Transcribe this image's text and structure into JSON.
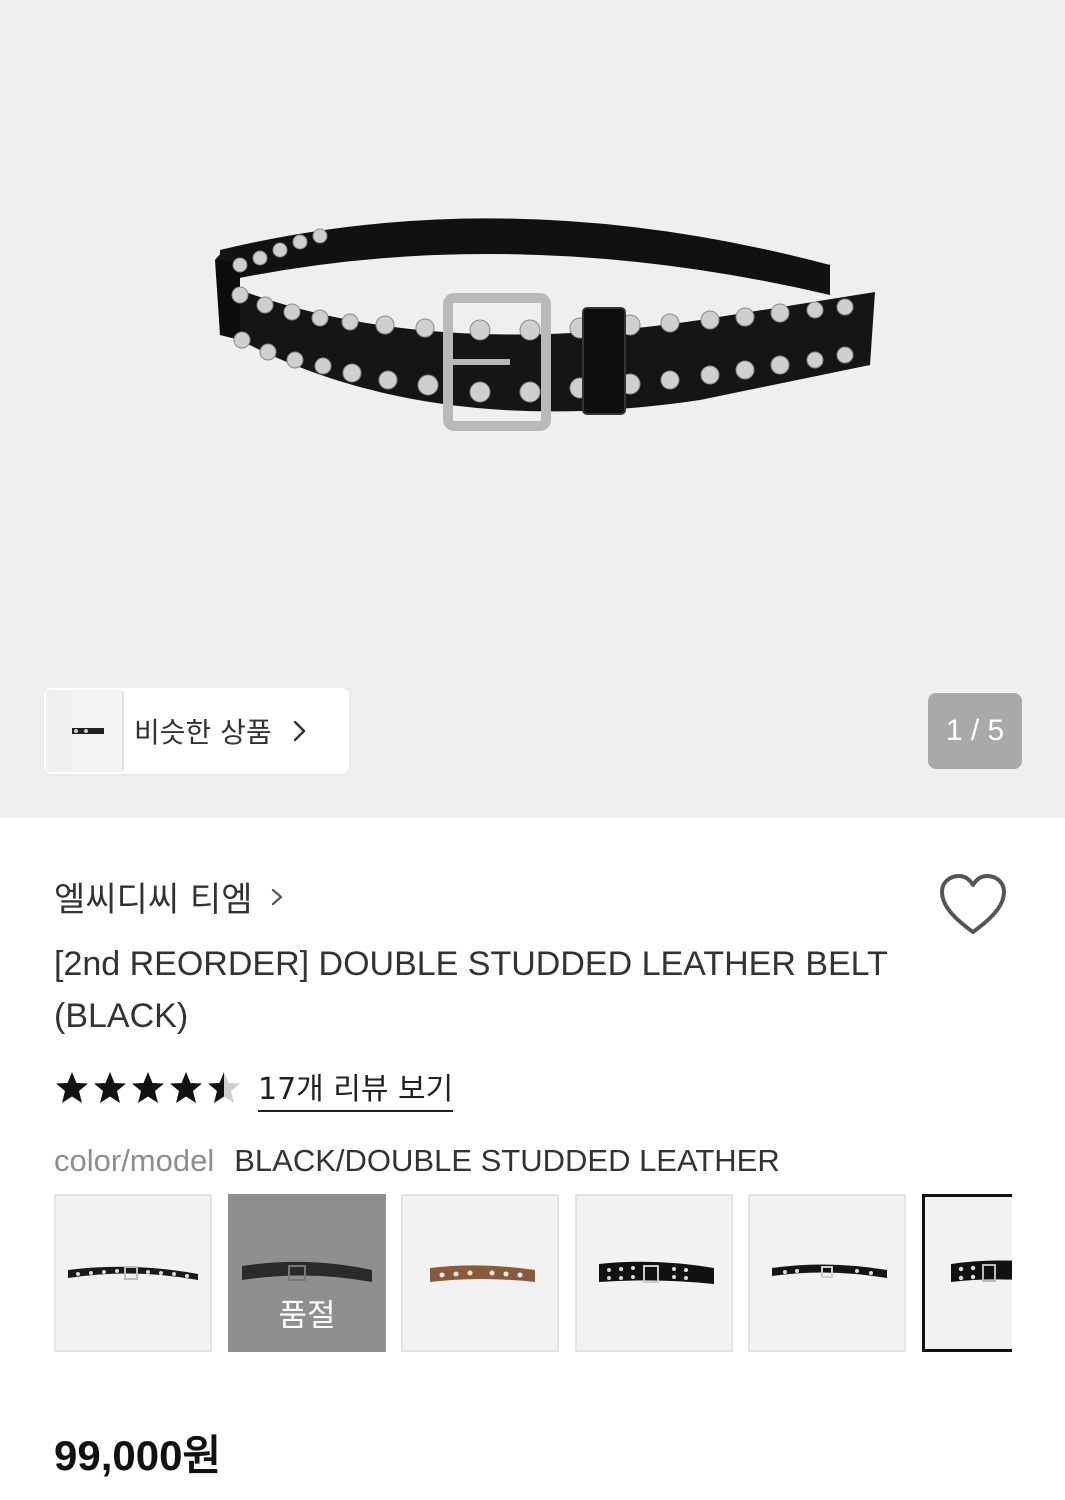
{
  "gallery": {
    "counter": "1 / 5",
    "similar_label": "비슷한 상품"
  },
  "product": {
    "brand": "엘씨디씨 티엠",
    "title": "[2nd REORDER] DOUBLE STUDDED LEATHER BELT (BLACK)",
    "rating": 4.5,
    "review_link": "17개 리뷰 보기",
    "option_label": "color/model",
    "option_value": "BLACK/DOUBLE STUDDED LEATHER",
    "price": "99,000원"
  },
  "variants": [
    {
      "id": "v1",
      "style": "single-eyelet-black",
      "status": ""
    },
    {
      "id": "v2",
      "style": "plain-black",
      "status": "품절"
    },
    {
      "id": "v3",
      "style": "eyelet-brown",
      "status": ""
    },
    {
      "id": "v4",
      "style": "double-eyelet-black",
      "status": ""
    },
    {
      "id": "v5",
      "style": "slim-black",
      "status": ""
    },
    {
      "id": "v6",
      "style": "double-studded-black",
      "status": "",
      "selected": true
    }
  ],
  "colors": {
    "hero_bg": "#efefef",
    "counter_bg": "#a9a9a9",
    "soldout_bg": "#8f8f8f",
    "text_main": "#333333",
    "text_muted": "#8e8e8e"
  },
  "icons": {
    "favorite": "heart-outline-icon",
    "chevron": "chevron-right-icon",
    "star": "star-icon"
  }
}
